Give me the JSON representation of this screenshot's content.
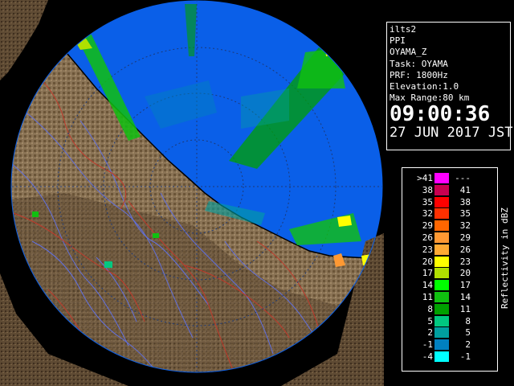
{
  "colors": {
    "background": "#000000",
    "sea": "#0a5fe8",
    "land": "#8a7355",
    "land_dark": "#5a4630",
    "rivers": "#5a6dd8",
    "boundaries": "#c0392b",
    "range_rings": "#1d3a78",
    "panel_text": "#ffffff"
  },
  "info": {
    "site": "ilts2",
    "product": "PPI",
    "field": "OYAMA_Z",
    "task": "Task: OYAMA",
    "prf": "PRF: 1800Hz",
    "elevation": "Elevation:1.0",
    "max_range": "Max Range:80 km",
    "time": "09:00:36",
    "date": "27 JUN 2017 JST"
  },
  "legend": {
    "axis_label": "Reflectivity in dBZ",
    "rows": [
      {
        "left": ">41",
        "right": "---",
        "color": "#ff00ff"
      },
      {
        "left": "38",
        "right": "41",
        "color": "#c80050"
      },
      {
        "left": "35",
        "right": "38",
        "color": "#ff0000"
      },
      {
        "left": "32",
        "right": "35",
        "color": "#ff3000"
      },
      {
        "left": "29",
        "right": "32",
        "color": "#ff6600"
      },
      {
        "left": "26",
        "right": "29",
        "color": "#ff9933"
      },
      {
        "left": "23",
        "right": "26",
        "color": "#ffaa33"
      },
      {
        "left": "20",
        "right": "23",
        "color": "#ffff00"
      },
      {
        "left": "17",
        "right": "20",
        "color": "#b0e000"
      },
      {
        "left": "14",
        "right": "17",
        "color": "#00ff00"
      },
      {
        "left": "11",
        "right": "14",
        "color": "#10c010"
      },
      {
        "left": "8",
        "right": "11",
        "color": "#00a000"
      },
      {
        "left": "5",
        "right": "8",
        "color": "#00c880"
      },
      {
        "left": "2",
        "right": "5",
        "color": "#00a0a0"
      },
      {
        "left": "-1",
        "right": "2",
        "color": "#0080c0"
      },
      {
        "left": "-4",
        "right": "-1",
        "color": "#00ffff"
      }
    ]
  }
}
